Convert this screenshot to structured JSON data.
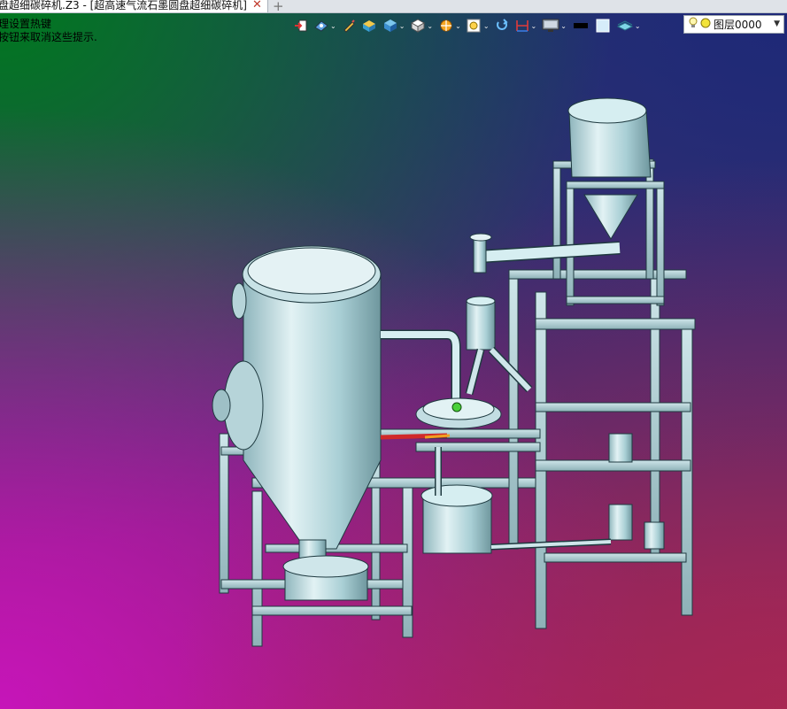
{
  "window": {
    "tab_title": "盘超细碳碎机.Z3 - [超高速气流石墨圆盘超细碳碎机]",
    "tab_close": "✕",
    "new_tab": "+"
  },
  "prompt": {
    "line1": "理设置热键",
    "line2": "按钮来取消这些提示."
  },
  "toolbar": {
    "icons": [
      "exit-icon",
      "view-orient-icon",
      "pencil-icon",
      "shaded-box-icon",
      "solid-box-icon",
      "white-cube-icon",
      "sun-light-icon",
      "zoom-icon",
      "rotate-icon",
      "dimension-icon",
      "monitor-icon",
      "black-rect-icon",
      "white-square-icon",
      "layer-shape-icon"
    ]
  },
  "layer": {
    "label": "图层0000"
  },
  "colors": {
    "model_fill": "#b8d8de",
    "model_stroke": "#1f3a40",
    "tab_close": "#c0392b"
  }
}
